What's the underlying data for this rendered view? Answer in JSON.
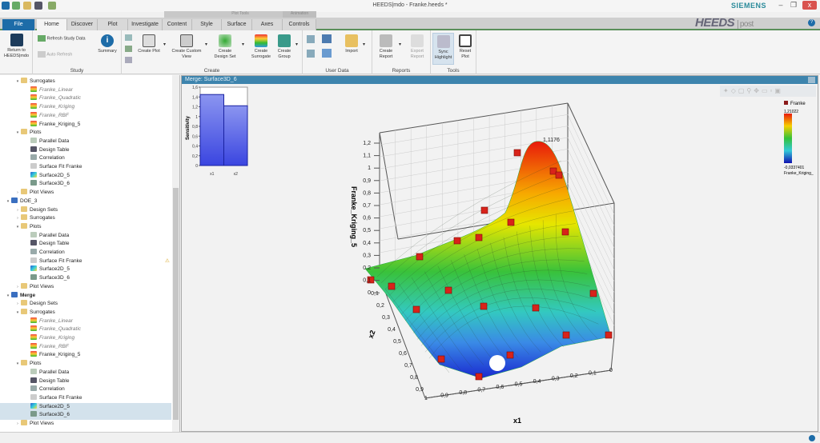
{
  "window": {
    "title": "HEEDS|mdo - Franke.heeds *",
    "brand": "SIEMENS",
    "logo": "HEEDS",
    "logo_sub": "post",
    "minimize": "–",
    "restore": "❐",
    "close": "x",
    "help": "?"
  },
  "context_headers": {
    "plot_tools": "Plot Tools",
    "animation": "Animation"
  },
  "tabs": [
    "File",
    "Home",
    "Discover",
    "Plot",
    "Investigate",
    "Content",
    "Style",
    "Surface",
    "Axes",
    "Controls"
  ],
  "active_tab": "Home",
  "ribbon": {
    "return_label": "Return to HEEDS|mdo",
    "refresh": "Refresh Study Data",
    "auto_refresh": "Auto Refresh",
    "summary": "Summary",
    "create_plot": "Create Plot",
    "create_custom_view": "Create Custom View",
    "create_design_set": "Create Design Set",
    "create_surrogate": "Create Surrogate",
    "create_group": "Create Group",
    "import": "Import",
    "create_report": "Create Report",
    "export_report": "Export Report",
    "sync_highlight": "Sync Highlight",
    "reset_plot": "Reset Plot",
    "groups": {
      "study": "Study",
      "create": "Create",
      "user_data": "User Data",
      "reports": "Reports",
      "tools": "Tools"
    }
  },
  "tree": [
    {
      "label": "Surrogates",
      "level": 1,
      "icon": "folder",
      "exp": "v"
    },
    {
      "label": "Franke_Linear",
      "level": 2,
      "icon": "surrogate",
      "style": "it"
    },
    {
      "label": "Franke_Quadratic",
      "level": 2,
      "icon": "surrogate",
      "style": "it"
    },
    {
      "label": "Franke_Kriging",
      "level": 2,
      "icon": "surrogate",
      "style": "it"
    },
    {
      "label": "Franke_RBF",
      "level": 2,
      "icon": "surrogate",
      "style": "it"
    },
    {
      "label": "Franke_Kriging_5",
      "level": 2,
      "icon": "surrogate"
    },
    {
      "label": "Plots",
      "level": 1,
      "icon": "folder",
      "exp": "v"
    },
    {
      "label": "Parallel Data",
      "level": 2,
      "icon": "parallel"
    },
    {
      "label": "Design Table",
      "level": 2,
      "icon": "table"
    },
    {
      "label": "Correlation",
      "level": 2,
      "icon": "grid"
    },
    {
      "label": "Surface Fit Franke",
      "level": 2,
      "icon": "fit"
    },
    {
      "label": "Surface2D_5",
      "level": 2,
      "icon": "s2d"
    },
    {
      "label": "Surface3D_6",
      "level": 2,
      "icon": "s3d"
    },
    {
      "label": "Plot Views",
      "level": 1,
      "icon": "folder",
      "exp": ">"
    },
    {
      "label": "DOE_3",
      "level": 0,
      "icon": "study",
      "exp": "v"
    },
    {
      "label": "Design Sets",
      "level": 1,
      "icon": "folder",
      "exp": ">"
    },
    {
      "label": "Surrogates",
      "level": 1,
      "icon": "folder",
      "exp": ">"
    },
    {
      "label": "Plots",
      "level": 1,
      "icon": "folder",
      "exp": "v"
    },
    {
      "label": "Parallel Data",
      "level": 2,
      "icon": "parallel"
    },
    {
      "label": "Design Table",
      "level": 2,
      "icon": "table"
    },
    {
      "label": "Correlation",
      "level": 2,
      "icon": "grid"
    },
    {
      "label": "Surface Fit Franke",
      "level": 2,
      "icon": "fit",
      "warn": true
    },
    {
      "label": "Surface2D_5",
      "level": 2,
      "icon": "s2d"
    },
    {
      "label": "Surface3D_6",
      "level": 2,
      "icon": "s3d"
    },
    {
      "label": "Plot Views",
      "level": 1,
      "icon": "folder",
      "exp": ">"
    },
    {
      "label": "Merge",
      "level": 0,
      "icon": "study",
      "exp": "v",
      "style": "bold"
    },
    {
      "label": "Design Sets",
      "level": 1,
      "icon": "folder",
      "exp": ">"
    },
    {
      "label": "Surrogates",
      "level": 1,
      "icon": "folder",
      "exp": "v"
    },
    {
      "label": "Franke_Linear",
      "level": 2,
      "icon": "surrogate",
      "style": "it"
    },
    {
      "label": "Franke_Quadratic",
      "level": 2,
      "icon": "surrogate",
      "style": "it"
    },
    {
      "label": "Franke_Kriging",
      "level": 2,
      "icon": "surrogate",
      "style": "it"
    },
    {
      "label": "Franke_RBF",
      "level": 2,
      "icon": "surrogate",
      "style": "it"
    },
    {
      "label": "Franke_Kriging_5",
      "level": 2,
      "icon": "surrogate"
    },
    {
      "label": "Plots",
      "level": 1,
      "icon": "folder",
      "exp": "v"
    },
    {
      "label": "Parallel Data",
      "level": 2,
      "icon": "parallel"
    },
    {
      "label": "Design Table",
      "level": 2,
      "icon": "table"
    },
    {
      "label": "Correlation",
      "level": 2,
      "icon": "grid"
    },
    {
      "label": "Surface Fit Franke",
      "level": 2,
      "icon": "fit"
    },
    {
      "label": "Surface2D_5",
      "level": 2,
      "icon": "s2d",
      "selected": true
    },
    {
      "label": "Surface3D_6",
      "level": 2,
      "icon": "s3d",
      "selected": true
    },
    {
      "label": "Plot Views",
      "level": 1,
      "icon": "folder",
      "exp": ">"
    }
  ],
  "plot": {
    "header": "Merge: Surface3D_6",
    "legend": {
      "series": "Franke",
      "max": "1,21022",
      "min": "-0,0337401",
      "variable": "Franke_Kriging_"
    },
    "zlabel": "Franke_Kriging_5",
    "xlabel": "x1",
    "ylabel": "x2",
    "peak_label": "1,1176",
    "z_ticks": [
      "1,2",
      "1,1",
      "1",
      "0,9",
      "0,8",
      "0,7",
      "0,6",
      "0,5",
      "0,4",
      "0,3",
      "0,2",
      "0,1",
      "0"
    ],
    "x1_ticks": [
      "1",
      "0,9",
      "0,8",
      "0,7",
      "0,6",
      "0,5",
      "0,4",
      "0,3",
      "0,2",
      "0,1",
      "0"
    ],
    "x2_ticks": [
      "0,1",
      "0,2",
      "0,3",
      "0,4",
      "0,5",
      "0,6",
      "0,7",
      "0,8",
      "0,9"
    ]
  },
  "chart_data": {
    "type": "bar",
    "title": "",
    "ylabel": "Sensitivity",
    "xlabel": "",
    "categories": [
      "x1",
      "x2"
    ],
    "values": [
      1.45,
      1.22
    ],
    "ylim": [
      0,
      1.6
    ],
    "y_ticks": [
      "0",
      "0,2",
      "0,4",
      "0,6",
      "0,8",
      "1",
      "1,2",
      "1,4",
      "1,6"
    ],
    "grid": true
  }
}
